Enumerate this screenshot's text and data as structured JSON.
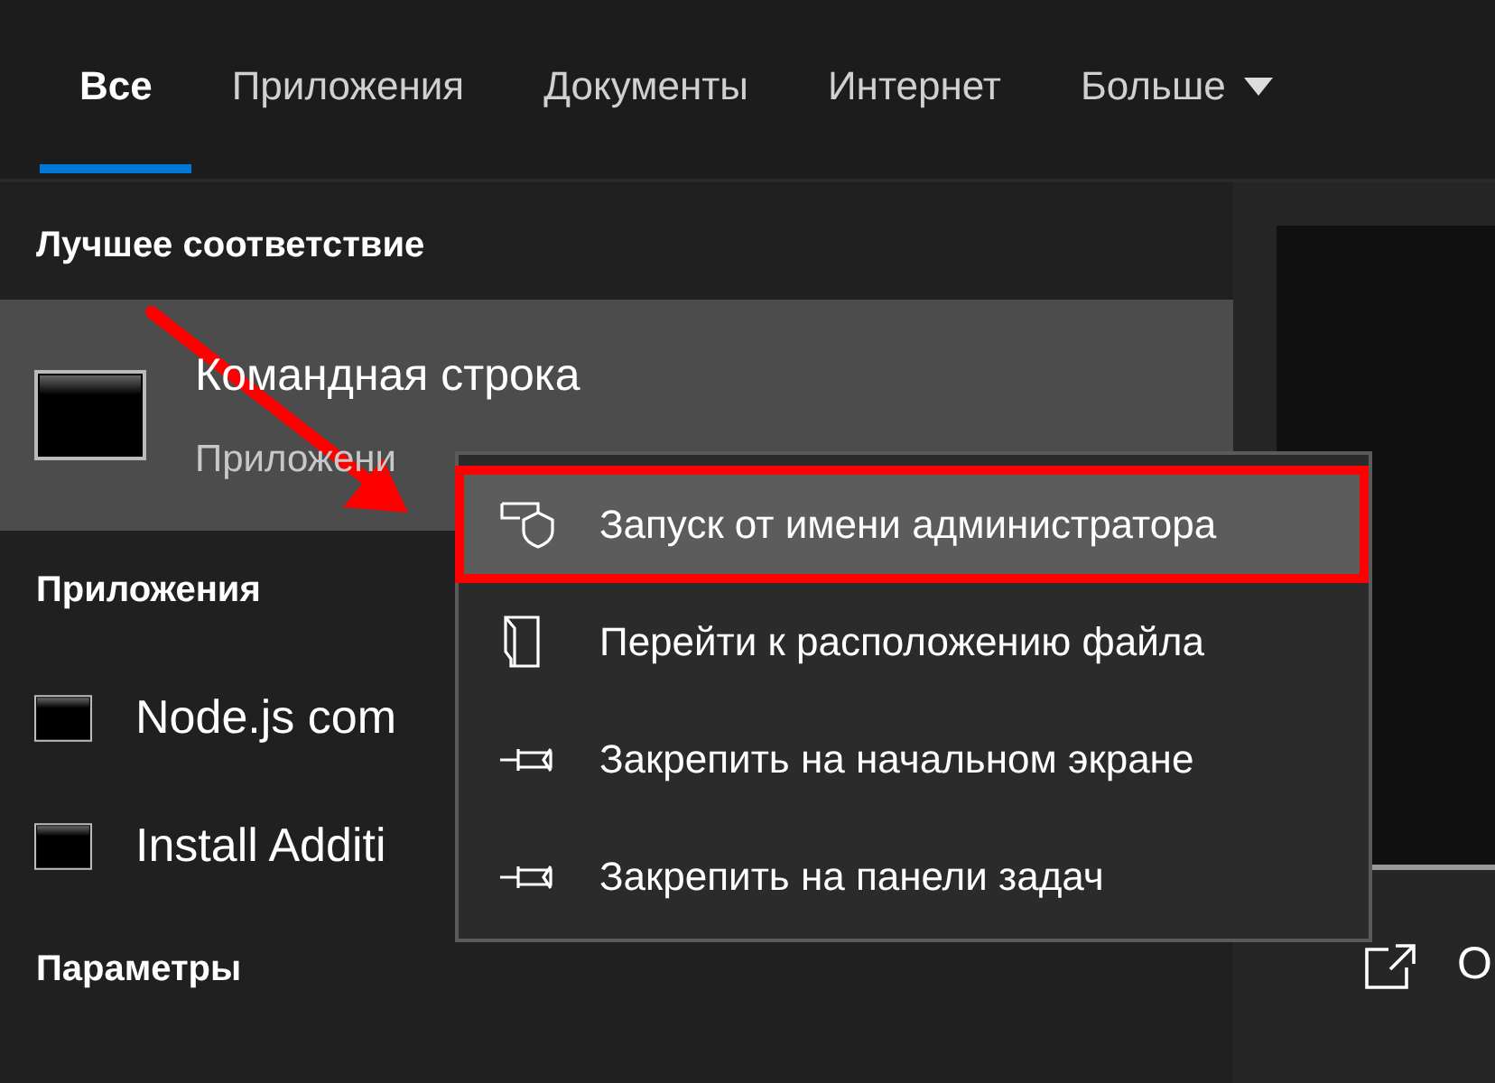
{
  "tabs": [
    {
      "label": "Все",
      "selected": true,
      "dropdown": false
    },
    {
      "label": "Приложения",
      "selected": false,
      "dropdown": false
    },
    {
      "label": "Документы",
      "selected": false,
      "dropdown": false
    },
    {
      "label": "Интернет",
      "selected": false,
      "dropdown": false
    },
    {
      "label": "Больше",
      "selected": false,
      "dropdown": true
    }
  ],
  "best_match": {
    "heading": "Лучшее соответствие",
    "title": "Командная строка",
    "subtitle": "Приложени"
  },
  "apps": {
    "heading": "Приложения",
    "items": [
      {
        "label": "Node.js com"
      },
      {
        "label": "Install Additi"
      }
    ]
  },
  "settings": {
    "heading": "Параметры"
  },
  "preview": {
    "action": "О"
  },
  "context_menu": {
    "items": [
      {
        "kind": "shield",
        "label": "Запуск от имени администратора",
        "selected": true,
        "highlighted": true
      },
      {
        "kind": "folder",
        "label": "Перейти к расположению файла",
        "selected": false,
        "highlighted": false
      },
      {
        "kind": "pin",
        "label": "Закрепить на начальном экране",
        "selected": false,
        "highlighted": false
      },
      {
        "kind": "pin",
        "label": "Закрепить на панели задач",
        "selected": false,
        "highlighted": false
      }
    ]
  },
  "annotation_arrow": true
}
